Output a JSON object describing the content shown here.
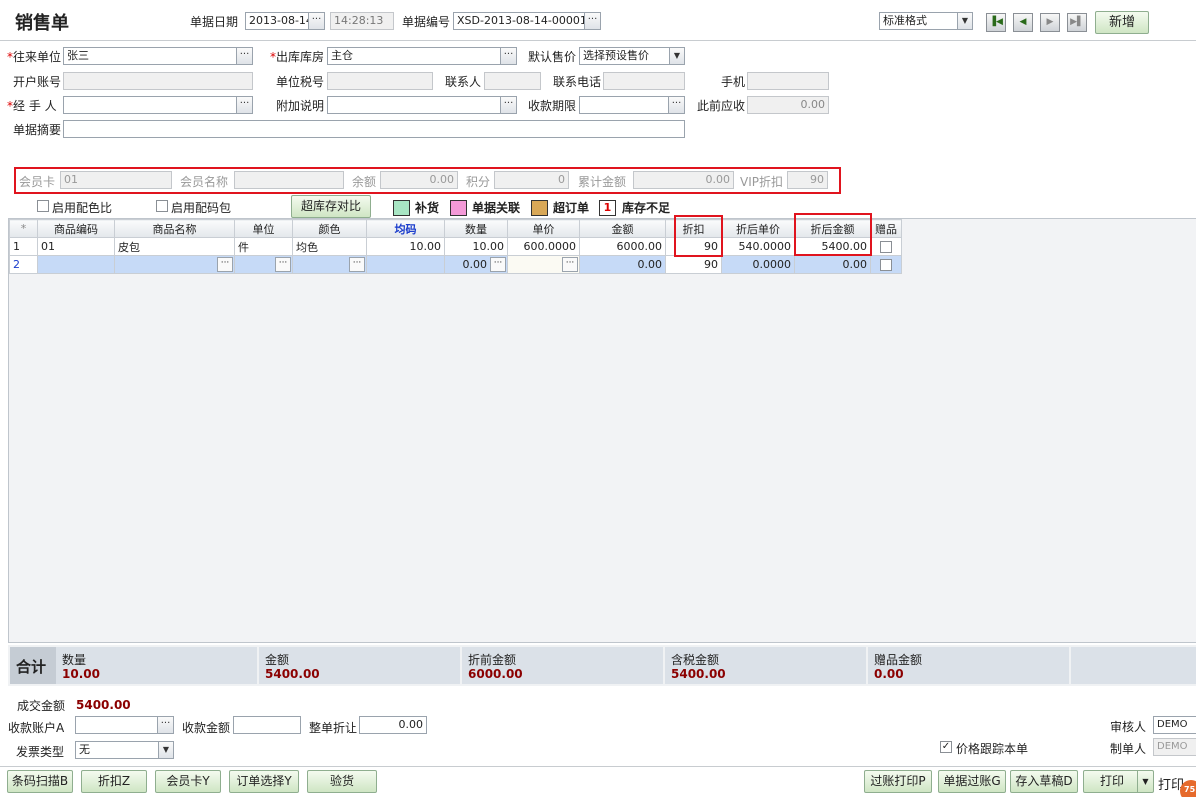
{
  "header": {
    "title": "销售单",
    "date_label": "单据日期",
    "date_value": "2013-08-14",
    "time_value": "14:28:13",
    "docno_label": "单据编号",
    "docno_value": "XSD-2013-08-14-00001",
    "format_value": "标准格式",
    "new_label": "新增"
  },
  "form": {
    "customer_label": "往来单位",
    "customer_value": "张三",
    "warehouse_label": "出库库房",
    "warehouse_value": "主仓",
    "price_label": "默认售价",
    "price_value": "选择预设售价",
    "account_label": "开户账号",
    "tax_label": "单位税号",
    "contact_label": "联系人",
    "phone_label": "联系电话",
    "mobile_label": "手机",
    "handler_label": "经 手 人",
    "remark_label": "附加说明",
    "term_label": "收款期限",
    "prev_label": "此前应收",
    "prev_value": "0.00",
    "summary_label": "单据摘要"
  },
  "member": {
    "card_label": "会员卡",
    "card_value": "01",
    "name_label": "会员名称",
    "balance_label": "余额",
    "balance_value": "0.00",
    "points_label": "积分",
    "points_value": "0",
    "total_label": "累计金额",
    "total_value": "0.00",
    "vip_label": "VIP折扣",
    "vip_value": "90"
  },
  "options": {
    "color_ratio": "启用配色比",
    "size_pack": "启用配码包",
    "overstock_btn": "超库存对比"
  },
  "legend": {
    "restock": "补货",
    "linked": "单据关联",
    "over_order": "超订单",
    "shortage_num": "1",
    "shortage": "库存不足",
    "colors": {
      "restock": "#a8e6c4",
      "linked": "#f49ad8",
      "over_order": "#d9a857"
    }
  },
  "grid": {
    "headers": [
      "*",
      "商品编码",
      "商品名称",
      "单位",
      "颜色",
      "均码",
      "数量",
      "单价",
      "金额",
      "折扣",
      "折后单价",
      "折后金额",
      "赠品"
    ],
    "rows": [
      [
        "1",
        "01",
        "皮包",
        "件",
        "均色",
        "10.00",
        "10.00",
        "600.0000",
        "6000.00",
        "90",
        "540.0000",
        "5400.00"
      ],
      [
        "2",
        "",
        "",
        "",
        "",
        "",
        "0.00",
        "",
        "0.00",
        "90",
        "0.0000",
        "0.00"
      ]
    ]
  },
  "totals": {
    "label": "合计",
    "qty_label": "数量",
    "qty_value": "10.00",
    "amount_label": "金额",
    "amount_value": "5400.00",
    "pre_label": "折前金额",
    "pre_value": "6000.00",
    "tax_label": "含税金额",
    "tax_value": "5400.00",
    "gift_label": "赠品金额",
    "gift_value": "0.00"
  },
  "footer": {
    "deal_label": "成交金额",
    "deal_value": "5400.00",
    "acct_label": "收款账户A",
    "recv_label": "收款金额",
    "discount_label": "整单折让",
    "discount_value": "0.00",
    "invoice_label": "发票类型",
    "invoice_value": "无",
    "track_label": "价格跟踪本单",
    "auditor_label": "审核人",
    "auditor_value": "DEMO",
    "maker_label": "制单人",
    "maker_value": "DEMO",
    "buttons": [
      "条码扫描B",
      "折扣Z",
      "会员卡Y",
      "订单选择Y",
      "验货"
    ],
    "right_buttons": [
      "过账打印P",
      "单据过账G",
      "存入草稿D",
      "打印"
    ],
    "print_trail": "打印",
    "badge": "75"
  }
}
